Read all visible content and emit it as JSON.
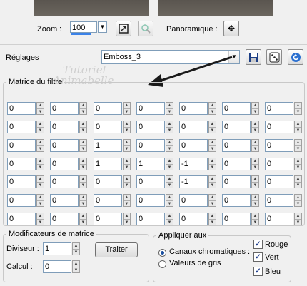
{
  "preview": {
    "zoom_label": "Zoom :",
    "zoom_value": "100",
    "pan_label": "Panoramique :"
  },
  "presets": {
    "label": "Réglages",
    "selected": "Emboss_3"
  },
  "watermark": {
    "line1": "Tutoriel",
    "line2": "Animabelle"
  },
  "matrix": {
    "title": "Matrice du filtre",
    "rows": [
      [
        "0",
        "0",
        "0",
        "0",
        "0",
        "0",
        "0"
      ],
      [
        "0",
        "0",
        "0",
        "0",
        "0",
        "0",
        "0"
      ],
      [
        "0",
        "0",
        "1",
        "0",
        "0",
        "0",
        "0"
      ],
      [
        "0",
        "0",
        "1",
        "1",
        "-1",
        "0",
        "0"
      ],
      [
        "0",
        "0",
        "0",
        "0",
        "-1",
        "0",
        "0"
      ],
      [
        "0",
        "0",
        "0",
        "0",
        "0",
        "0",
        "0"
      ],
      [
        "0",
        "0",
        "0",
        "0",
        "0",
        "0",
        "0"
      ]
    ]
  },
  "modifiers": {
    "title": "Modificateurs de matrice",
    "divisor_label": "Diviseur :",
    "divisor_value": "1",
    "bias_label": "Calcul :",
    "bias_value": "0",
    "apply_button": "Traiter"
  },
  "apply_to": {
    "title": "Appliquer aux",
    "option_channels": "Canaux chromatiques :",
    "option_gray": "Valeurs de gris",
    "red": "Rouge",
    "green": "Vert",
    "blue": "Bleu"
  }
}
